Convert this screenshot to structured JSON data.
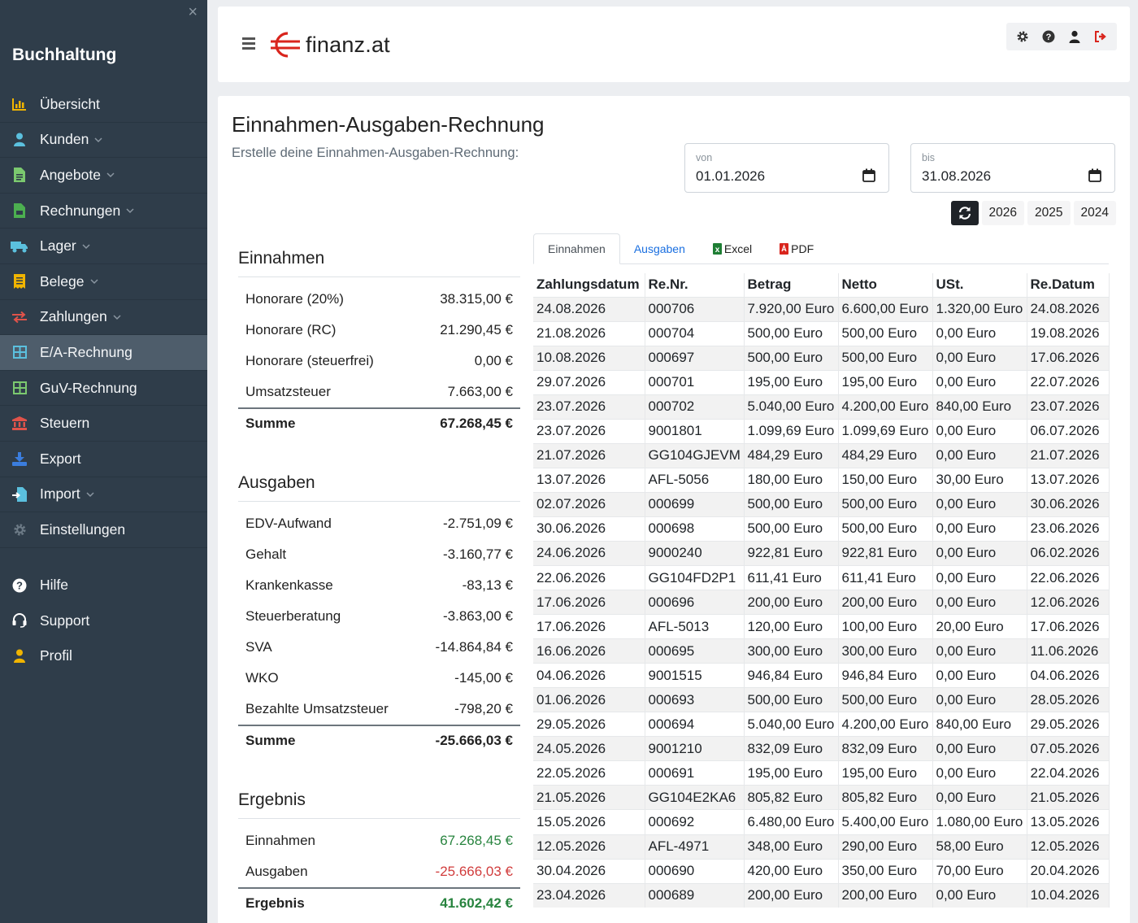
{
  "sidebar": {
    "title": "Buchhaltung",
    "close": "×",
    "items": [
      {
        "label": "Übersicht",
        "icon": "chart-bar-icon",
        "color": "#f0b400",
        "chevron": false
      },
      {
        "label": "Kunden",
        "icon": "user-icon",
        "color": "#5bc0de",
        "chevron": true
      },
      {
        "label": "Angebote",
        "icon": "file-icon",
        "color": "#7bc96f",
        "chevron": true
      },
      {
        "label": "Rechnungen",
        "icon": "file-invoice-icon",
        "color": "#4caf50",
        "chevron": true
      },
      {
        "label": "Lager",
        "icon": "truck-icon",
        "color": "#5bc0de",
        "chevron": true
      },
      {
        "label": "Belege",
        "icon": "receipt-icon",
        "color": "#f0b400",
        "chevron": true
      },
      {
        "label": "Zahlungen",
        "icon": "exchange-icon",
        "color": "#e0534a",
        "chevron": true
      },
      {
        "label": "E/A-Rechnung",
        "icon": "table-icon",
        "color": "#5bc0de",
        "chevron": false,
        "active": true
      },
      {
        "label": "GuV-Rechnung",
        "icon": "table-icon",
        "color": "#7bc96f",
        "chevron": false
      },
      {
        "label": "Steuern",
        "icon": "bank-icon",
        "color": "#e0534a",
        "chevron": false
      },
      {
        "label": "Export",
        "icon": "download-icon",
        "color": "#3b7ddd",
        "chevron": false
      },
      {
        "label": "Import",
        "icon": "import-icon",
        "color": "#5bc0de",
        "chevron": true
      },
      {
        "label": "Einstellungen",
        "icon": "gear-icon",
        "color": "#6c7a86",
        "chevron": false
      }
    ],
    "bottom_items": [
      {
        "label": "Hilfe",
        "icon": "question-icon",
        "color": "#ffffff"
      },
      {
        "label": "Support",
        "icon": "headset-icon",
        "color": "#ffffff"
      },
      {
        "label": "Profil",
        "icon": "user-icon",
        "color": "#f0b400"
      }
    ]
  },
  "header": {
    "logo_text": "finanz.at",
    "icons": [
      "gear-icon",
      "question-icon",
      "user-icon",
      "logout-icon"
    ]
  },
  "page": {
    "title": "Einnahmen-Ausgaben-Rechnung",
    "subtitle": "Erstelle deine Einnahmen-Ausgaben-Rechnung:",
    "from_label": "von",
    "from_value": "01.01.2026",
    "to_label": "bis",
    "to_value": "31.08.2026",
    "years": [
      "2026",
      "2025",
      "2024"
    ]
  },
  "summary": {
    "einnahmen": {
      "heading": "Einnahmen",
      "rows": [
        {
          "label": "Honorare (20%)",
          "value": "38.315,00 €"
        },
        {
          "label": "Honorare (RC)",
          "value": "21.290,45 €"
        },
        {
          "label": "Honorare (steuerfrei)",
          "value": "0,00 €"
        },
        {
          "label": "Umsatzsteuer",
          "value": "7.663,00 €"
        }
      ],
      "total_label": "Summe",
      "total_value": "67.268,45 €"
    },
    "ausgaben": {
      "heading": "Ausgaben",
      "rows": [
        {
          "label": "EDV-Aufwand",
          "value": "-2.751,09 €"
        },
        {
          "label": "Gehalt",
          "value": "-3.160,77 €"
        },
        {
          "label": "Krankenkasse",
          "value": "-83,13 €"
        },
        {
          "label": "Steuerberatung",
          "value": "-3.863,00 €"
        },
        {
          "label": "SVA",
          "value": "-14.864,84 €"
        },
        {
          "label": "WKO",
          "value": "-145,00 €"
        },
        {
          "label": "Bezahlte Umsatzsteuer",
          "value": "-798,20 €"
        }
      ],
      "total_label": "Summe",
      "total_value": "-25.666,03 €"
    },
    "ergebnis": {
      "heading": "Ergebnis",
      "einnahmen_label": "Einnahmen",
      "einnahmen_value": "67.268,45 €",
      "ausgaben_label": "Ausgaben",
      "ausgaben_value": "-25.666,03 €",
      "total_label": "Ergebnis",
      "total_value": "41.602,42 €"
    }
  },
  "tabs": [
    {
      "label": "Einnahmen",
      "active": true
    },
    {
      "label": "Ausgaben",
      "link": true
    },
    {
      "label": "Excel",
      "icon": "excel-icon"
    },
    {
      "label": "PDF",
      "icon": "pdf-icon"
    }
  ],
  "table": {
    "columns": [
      "Zahlungsdatum",
      "Re.Nr.",
      "Betrag",
      "Netto",
      "USt.",
      "Re.Datum"
    ],
    "rows": [
      [
        "24.08.2026",
        "000706",
        "7.920,00 Euro",
        "6.600,00 Euro",
        "1.320,00 Euro",
        "24.08.2026"
      ],
      [
        "21.08.2026",
        "000704",
        "500,00 Euro",
        "500,00 Euro",
        "0,00 Euro",
        "19.08.2026"
      ],
      [
        "10.08.2026",
        "000697",
        "500,00 Euro",
        "500,00 Euro",
        "0,00 Euro",
        "17.06.2026"
      ],
      [
        "29.07.2026",
        "000701",
        "195,00 Euro",
        "195,00 Euro",
        "0,00 Euro",
        "22.07.2026"
      ],
      [
        "23.07.2026",
        "000702",
        "5.040,00 Euro",
        "4.200,00 Euro",
        "840,00 Euro",
        "23.07.2026"
      ],
      [
        "23.07.2026",
        "9001801",
        "1.099,69 Euro",
        "1.099,69 Euro",
        "0,00 Euro",
        "06.07.2026"
      ],
      [
        "21.07.2026",
        "GG104GJEVM",
        "484,29 Euro",
        "484,29 Euro",
        "0,00 Euro",
        "21.07.2026"
      ],
      [
        "13.07.2026",
        "AFL-5056",
        "180,00 Euro",
        "150,00 Euro",
        "30,00 Euro",
        "13.07.2026"
      ],
      [
        "02.07.2026",
        "000699",
        "500,00 Euro",
        "500,00 Euro",
        "0,00 Euro",
        "30.06.2026"
      ],
      [
        "30.06.2026",
        "000698",
        "500,00 Euro",
        "500,00 Euro",
        "0,00 Euro",
        "23.06.2026"
      ],
      [
        "24.06.2026",
        "9000240",
        "922,81 Euro",
        "922,81 Euro",
        "0,00 Euro",
        "06.02.2026"
      ],
      [
        "22.06.2026",
        "GG104FD2P1",
        "611,41 Euro",
        "611,41 Euro",
        "0,00 Euro",
        "22.06.2026"
      ],
      [
        "17.06.2026",
        "000696",
        "200,00 Euro",
        "200,00 Euro",
        "0,00 Euro",
        "12.06.2026"
      ],
      [
        "17.06.2026",
        "AFL-5013",
        "120,00 Euro",
        "100,00 Euro",
        "20,00 Euro",
        "17.06.2026"
      ],
      [
        "16.06.2026",
        "000695",
        "300,00 Euro",
        "300,00 Euro",
        "0,00 Euro",
        "11.06.2026"
      ],
      [
        "04.06.2026",
        "9001515",
        "946,84 Euro",
        "946,84 Euro",
        "0,00 Euro",
        "04.06.2026"
      ],
      [
        "01.06.2026",
        "000693",
        "500,00 Euro",
        "500,00 Euro",
        "0,00 Euro",
        "28.05.2026"
      ],
      [
        "29.05.2026",
        "000694",
        "5.040,00 Euro",
        "4.200,00 Euro",
        "840,00 Euro",
        "29.05.2026"
      ],
      [
        "24.05.2026",
        "9001210",
        "832,09 Euro",
        "832,09 Euro",
        "0,00 Euro",
        "07.05.2026"
      ],
      [
        "22.05.2026",
        "000691",
        "195,00 Euro",
        "195,00 Euro",
        "0,00 Euro",
        "22.04.2026"
      ],
      [
        "21.05.2026",
        "GG104E2KA6",
        "805,82 Euro",
        "805,82 Euro",
        "0,00 Euro",
        "21.05.2026"
      ],
      [
        "15.05.2026",
        "000692",
        "6.480,00 Euro",
        "5.400,00 Euro",
        "1.080,00 Euro",
        "13.05.2026"
      ],
      [
        "12.05.2026",
        "AFL-4971",
        "348,00 Euro",
        "290,00 Euro",
        "58,00 Euro",
        "12.05.2026"
      ],
      [
        "30.04.2026",
        "000690",
        "420,00 Euro",
        "350,00 Euro",
        "70,00 Euro",
        "20.04.2026"
      ],
      [
        "23.04.2026",
        "000689",
        "200,00 Euro",
        "200,00 Euro",
        "0,00 Euro",
        "10.04.2026"
      ]
    ]
  }
}
